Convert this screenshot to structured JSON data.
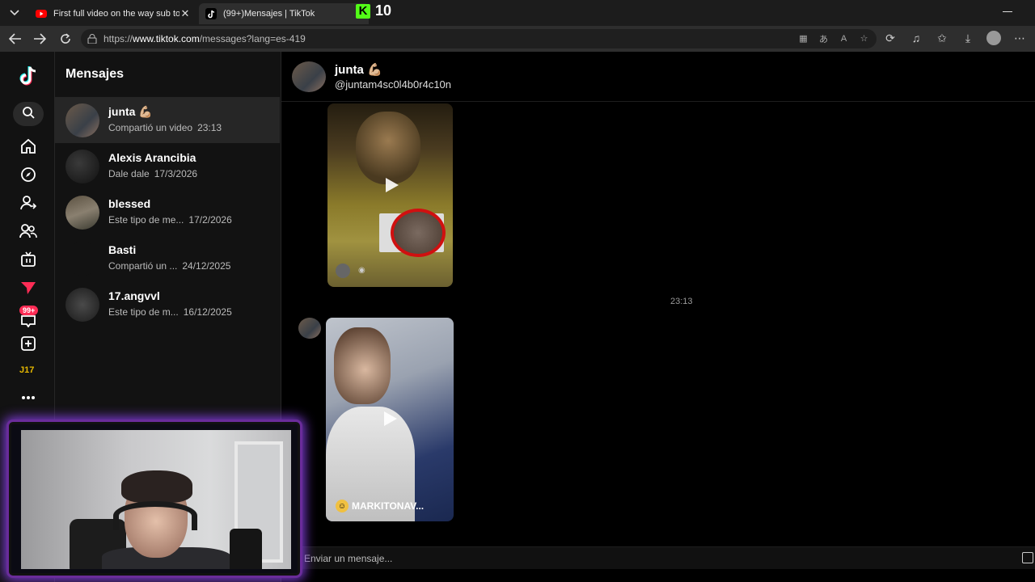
{
  "browser": {
    "tabs": [
      {
        "title": "First full video on the way sub to g",
        "favicon": "youtube-icon",
        "favicon_color": "#ff0000"
      },
      {
        "title": "(99+)Mensajes | TikTok",
        "favicon": "tiktok-icon",
        "active": true
      }
    ],
    "kick_badge": {
      "count": "10",
      "color": "#53fc18"
    },
    "url_prefix": "https://",
    "url_host": "www.tiktok.com",
    "url_path": "/messages?lang=es-419"
  },
  "rail": {
    "notification_badge": "99+",
    "brand_tag": "J17",
    "icons": [
      "tiktok-logo-icon",
      "search-icon",
      "home-icon",
      "explore-icon",
      "following-icon",
      "friends-icon",
      "live-icon",
      "messages-icon",
      "inbox-icon",
      "upload-icon",
      "profile-icon",
      "more-icon"
    ]
  },
  "conversations": {
    "title": "Mensajes",
    "items": [
      {
        "name": "junta 💪🏼",
        "preview": "Compartió un video",
        "date": "23:13",
        "active": true
      },
      {
        "name": "Alexis Arancibia",
        "preview": "Dale dale",
        "date": "17/3/2026"
      },
      {
        "name": "blessed",
        "preview": "Este tipo de me...",
        "date": "17/2/2026"
      },
      {
        "name": "Basti",
        "preview": "Compartió un ...",
        "date": "24/12/2025"
      },
      {
        "name": "17.angvvl",
        "preview": "Este tipo de m...",
        "date": "16/12/2025"
      }
    ]
  },
  "chat": {
    "name": "junta 💪🏼",
    "handle": "@juntam4sc0l4b0r4c10n",
    "timestamp": "23:13",
    "video2_caption": "MARKITONAV...",
    "composer_placeholder": "Enviar un mensaje..."
  },
  "colors": {
    "accent_red": "#fe2c55",
    "background": "#000000",
    "panel": "#121212",
    "webcam_frame": "#6a2c9a"
  }
}
